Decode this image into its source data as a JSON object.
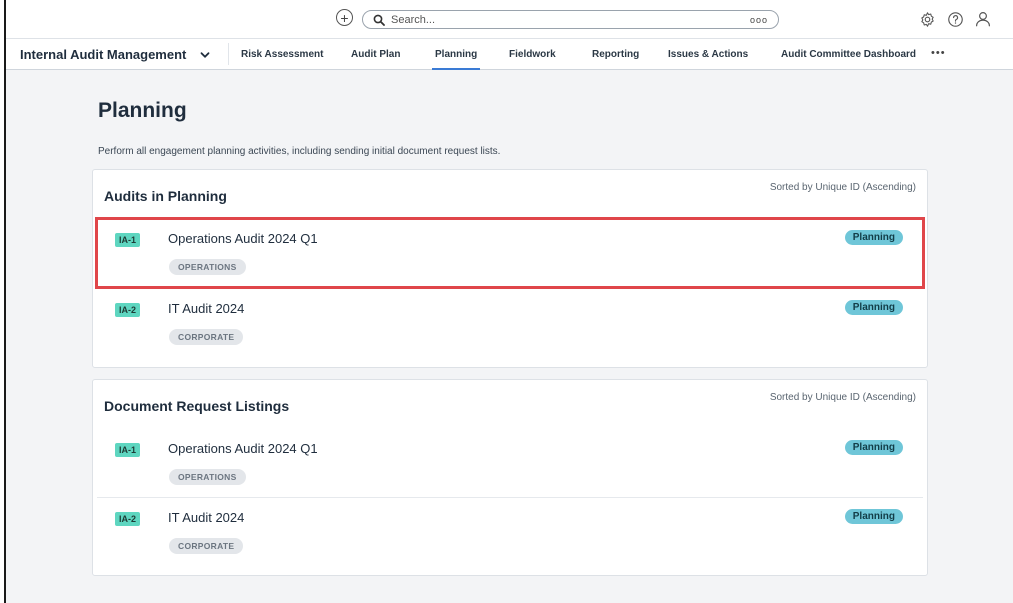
{
  "colors": {
    "accent": "#3a7bd5",
    "id_badge": "#5ed6c0",
    "status_badge": "#6fc6d8",
    "highlight": "#e0464a",
    "page_bg": "#f3f4f6"
  },
  "topbar": {
    "add_icon": "plus-circle-icon",
    "search": {
      "placeholder": "Search...",
      "more_label": "ooo"
    },
    "icons": [
      "gear-icon",
      "help-icon",
      "user-icon"
    ]
  },
  "nav": {
    "app_name": "Internal Audit Management",
    "tabs": [
      {
        "label": "Risk Assessment"
      },
      {
        "label": "Audit Plan"
      },
      {
        "label": "Planning"
      },
      {
        "label": "Fieldwork"
      },
      {
        "label": "Reporting"
      },
      {
        "label": "Issues & Actions"
      },
      {
        "label": "Audit Committee Dashboard"
      }
    ],
    "active_tab": "Planning",
    "more_label": "•••"
  },
  "page": {
    "title": "Planning",
    "description": "Perform all engagement planning activities, including sending initial document request lists."
  },
  "audits_in_planning": {
    "title": "Audits in Planning",
    "sort_label": "Sorted by Unique ID (Ascending)",
    "rows": [
      {
        "id": "IA-1",
        "name": "Operations Audit 2024 Q1",
        "tag": "OPERATIONS",
        "status": "Planning"
      },
      {
        "id": "IA-2",
        "name": "IT Audit 2024",
        "tag": "CORPORATE",
        "status": "Planning"
      }
    ]
  },
  "document_request_listings": {
    "title": "Document Request Listings",
    "sort_label": "Sorted by Unique ID (Ascending)",
    "rows": [
      {
        "id": "IA-1",
        "name": "Operations Audit 2024 Q1",
        "tag": "OPERATIONS",
        "status": "Planning"
      },
      {
        "id": "IA-2",
        "name": "IT Audit 2024",
        "tag": "CORPORATE",
        "status": "Planning"
      }
    ]
  }
}
